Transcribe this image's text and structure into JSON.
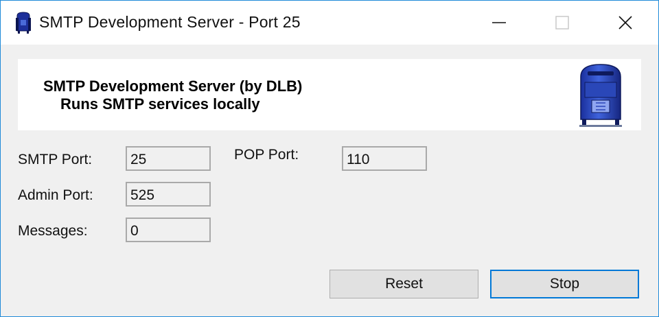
{
  "window": {
    "title": "SMTP Development Server - Port 25",
    "controls": {
      "minimize_icon": "minimize-icon",
      "maximize_icon": "maximize-icon",
      "close_icon": "close-icon"
    }
  },
  "banner": {
    "title": "SMTP Development Server (by DLB)",
    "subtitle": "Runs SMTP services locally",
    "icon": "mailbox-icon"
  },
  "fields": {
    "smtp_port": {
      "label": "SMTP Port:",
      "value": "25"
    },
    "pop_port": {
      "label": "POP Port:",
      "value": "110"
    },
    "admin_port": {
      "label": "Admin Port:",
      "value": "525"
    },
    "messages": {
      "label": "Messages:",
      "value": "0"
    }
  },
  "buttons": {
    "reset_label": "Reset",
    "stop_label": "Stop"
  },
  "colors": {
    "window_border": "#1f8ad8",
    "default_button_border": "#0078d7",
    "mailbox_blue": "#2b50c8"
  }
}
